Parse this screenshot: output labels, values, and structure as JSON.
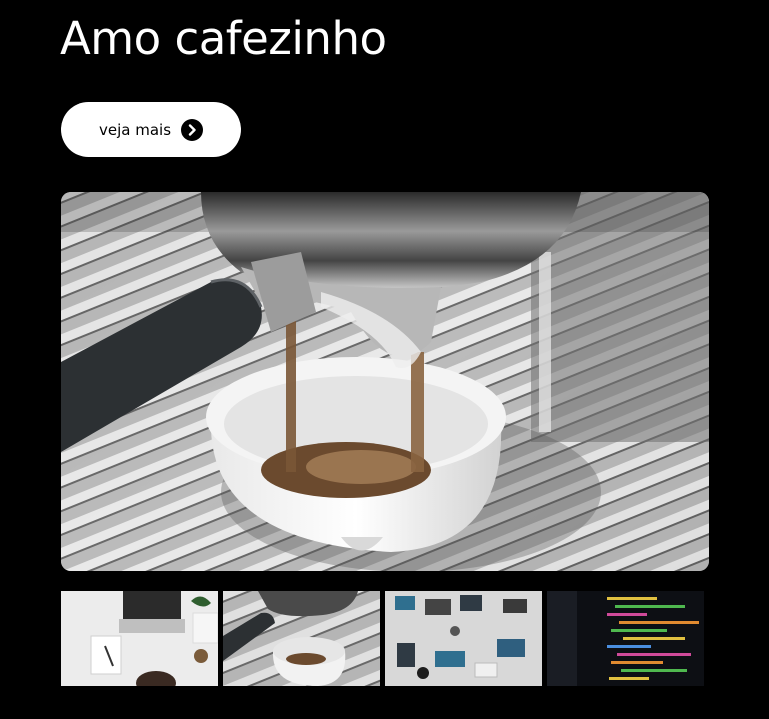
{
  "hero": {
    "title": "Amo cafezinho",
    "cta_label": "veja mais",
    "cta_icon": "chevron-right-circle-icon"
  },
  "main_image": {
    "subject": "espresso-pouring-into-white-cup"
  },
  "thumbnails": [
    {
      "subject": "laptop-desk-top-view"
    },
    {
      "subject": "espresso-pouring-into-white-cup"
    },
    {
      "subject": "team-desks-top-view"
    },
    {
      "subject": "code-on-screen"
    }
  ],
  "colors": {
    "background": "#000000",
    "title": "#ffffff",
    "button_bg": "#ffffff",
    "button_text": "#000000"
  }
}
